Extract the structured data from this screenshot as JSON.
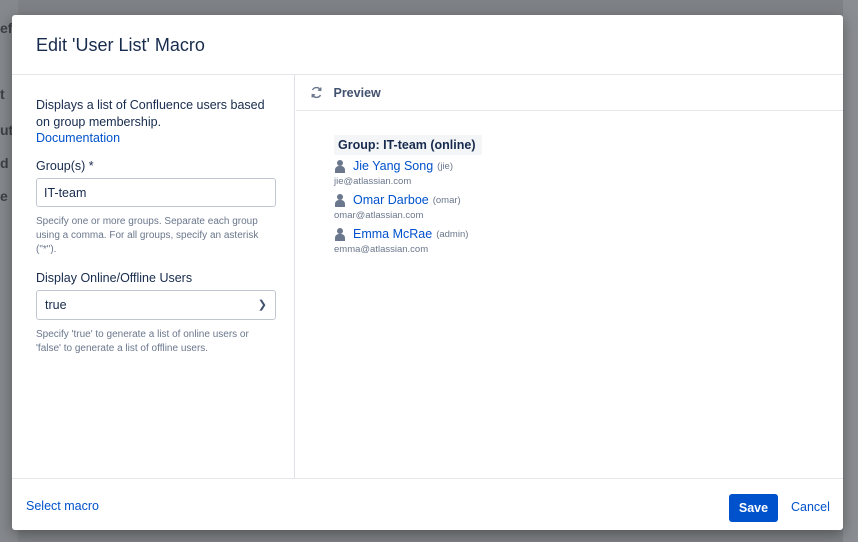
{
  "background": {
    "peek_chars": [
      "ef",
      "t",
      "ut",
      "d",
      "e"
    ]
  },
  "dialog": {
    "title": "Edit 'User List' Macro"
  },
  "left_pane": {
    "description": "Displays a list of Confluence users based on group membership.",
    "documentation_link": "Documentation",
    "groups_label": "Group(s) *",
    "groups_value": "IT-team",
    "groups_help": "Specify one or more groups. Separate each group using a comma. For all groups, specify an asterisk (\"*\").",
    "online_label": "Display Online/Offline Users",
    "online_value": "true",
    "online_help": "Specify 'true' to generate a list of online users or 'false' to generate a list of offline users."
  },
  "preview": {
    "header": "Preview",
    "group_title": "Group: IT-team (online)",
    "users": [
      {
        "name": "Jie Yang Song",
        "handle": "(jie)",
        "email": "jie@atlassian.com"
      },
      {
        "name": "Omar Darboe",
        "handle": "(omar)",
        "email": "omar@atlassian.com"
      },
      {
        "name": "Emma McRae",
        "handle": "(admin)",
        "email": "emma@atlassian.com"
      }
    ]
  },
  "footer": {
    "select_macro": "Select macro",
    "save": "Save",
    "cancel": "Cancel"
  },
  "colors": {
    "primary": "#0052cc",
    "text": "#172b4d",
    "subtle": "#6b778c"
  }
}
